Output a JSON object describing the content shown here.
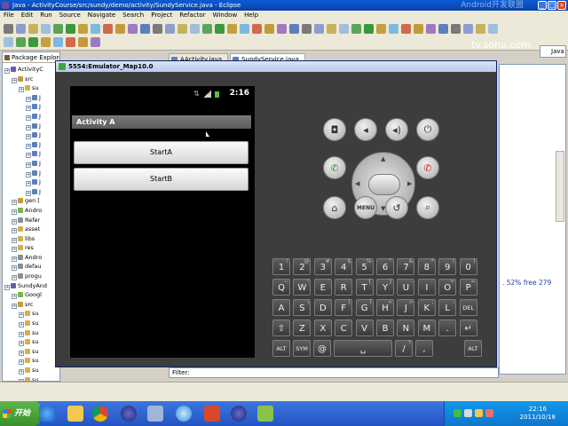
{
  "ide": {
    "window_title": "Java - ActivityCourse/src/sundy/demo/activity/SundyService.java - Eclipse",
    "watermark": "Android开发联盟",
    "menus": [
      "File",
      "Edit",
      "Run",
      "Source",
      "Navigate",
      "Search",
      "Project",
      "Refactor",
      "Window",
      "Help"
    ],
    "perspective": "Java",
    "package_explorer_title": "Package Explorer",
    "editor_tabs": [
      "AActivity.java",
      "SundyService.java"
    ],
    "heap_text": ". 52% free 279",
    "filter_label": "Filter:",
    "filter_value": "",
    "sohu": "tv.sohu.com"
  },
  "tree": [
    {
      "label": "ActivityC",
      "indent": 0,
      "color": "#6b5ba8"
    },
    {
      "label": "src",
      "indent": 1,
      "color": "#c49a3a"
    },
    {
      "label": "su",
      "indent": 2,
      "color": "#d4b04a"
    },
    {
      "label": "J",
      "indent": 3,
      "color": "#5c7fbd"
    },
    {
      "label": "J",
      "indent": 3,
      "color": "#5c7fbd"
    },
    {
      "label": "J",
      "indent": 3,
      "color": "#5c7fbd"
    },
    {
      "label": "J",
      "indent": 3,
      "color": "#5c7fbd"
    },
    {
      "label": "J",
      "indent": 3,
      "color": "#5c7fbd"
    },
    {
      "label": "J",
      "indent": 3,
      "color": "#5c7fbd"
    },
    {
      "label": "J",
      "indent": 3,
      "color": "#5c7fbd"
    },
    {
      "label": "J",
      "indent": 3,
      "color": "#5c7fbd"
    },
    {
      "label": "J",
      "indent": 3,
      "color": "#5c7fbd"
    },
    {
      "label": "J",
      "indent": 3,
      "color": "#5c7fbd"
    },
    {
      "label": "J",
      "indent": 3,
      "color": "#5c7fbd"
    },
    {
      "label": "gen [",
      "indent": 1,
      "color": "#c49a3a"
    },
    {
      "label": "Andro",
      "indent": 1,
      "color": "#7cb342"
    },
    {
      "label": "Refer",
      "indent": 1,
      "color": "#8d8d8d"
    },
    {
      "label": "asset",
      "indent": 1,
      "color": "#d4b04a"
    },
    {
      "label": "libs",
      "indent": 1,
      "color": "#d4b04a"
    },
    {
      "label": "res",
      "indent": 1,
      "color": "#d4b04a"
    },
    {
      "label": "Andro",
      "indent": 1,
      "color": "#8d8d8d"
    },
    {
      "label": "defau",
      "indent": 1,
      "color": "#8d8d8d"
    },
    {
      "label": "progu",
      "indent": 1,
      "color": "#8d8d8d"
    },
    {
      "label": "SundyAnd",
      "indent": 0,
      "color": "#6b5ba8"
    },
    {
      "label": "Googl",
      "indent": 1,
      "color": "#7cb342"
    },
    {
      "label": "src",
      "indent": 1,
      "color": "#c49a3a"
    },
    {
      "label": "su",
      "indent": 2,
      "color": "#d4b04a"
    },
    {
      "label": "su",
      "indent": 2,
      "color": "#d4b04a"
    },
    {
      "label": "su",
      "indent": 2,
      "color": "#d4b04a"
    },
    {
      "label": "su",
      "indent": 2,
      "color": "#d4b04a"
    },
    {
      "label": "su",
      "indent": 2,
      "color": "#d4b04a"
    },
    {
      "label": "su",
      "indent": 2,
      "color": "#d4b04a"
    },
    {
      "label": "su",
      "indent": 2,
      "color": "#d4b04a"
    },
    {
      "label": "su",
      "indent": 2,
      "color": "#d4b04a"
    },
    {
      "label": "su",
      "indent": 2,
      "color": "#d4b04a"
    },
    {
      "label": "su",
      "indent": 2,
      "color": "#d4b04a"
    }
  ],
  "emulator": {
    "title": "5554:Emulator_Map10.0",
    "clock": "2:16",
    "activity_title": "Activity A",
    "button_a": "StartA",
    "button_b": "StartB",
    "menu_label": "MENU"
  },
  "keyboard": {
    "rows": [
      [
        {
          "k": "1",
          "s": "!"
        },
        {
          "k": "2",
          "s": "@"
        },
        {
          "k": "3",
          "s": "#"
        },
        {
          "k": "4",
          "s": "$"
        },
        {
          "k": "5",
          "s": "%"
        },
        {
          "k": "6",
          "s": "^"
        },
        {
          "k": "7",
          "s": "&"
        },
        {
          "k": "8",
          "s": "*"
        },
        {
          "k": "9",
          "s": "("
        },
        {
          "k": "0",
          "s": ")"
        }
      ],
      [
        {
          "k": "Q",
          "s": "~"
        },
        {
          "k": "W",
          "s": "\""
        },
        {
          "k": "E",
          "s": "`"
        },
        {
          "k": "R",
          "s": ""
        },
        {
          "k": "T",
          "s": "{"
        },
        {
          "k": "Y",
          "s": "}"
        },
        {
          "k": "U",
          "s": "-"
        },
        {
          "k": "I",
          "s": ""
        },
        {
          "k": "O",
          "s": "+"
        },
        {
          "k": "P",
          "s": "="
        }
      ],
      [
        {
          "k": "A",
          "s": ""
        },
        {
          "k": "S",
          "s": "\\"
        },
        {
          "k": "D",
          "s": ""
        },
        {
          "k": "F",
          "s": "["
        },
        {
          "k": "G",
          "s": "]"
        },
        {
          "k": "H",
          "s": "<"
        },
        {
          "k": "J",
          "s": ">"
        },
        {
          "k": "K",
          "s": ";"
        },
        {
          "k": "L",
          "s": ":"
        },
        {
          "k": "DEL",
          "s": ""
        }
      ],
      [
        {
          "k": "⇧",
          "s": ""
        },
        {
          "k": "Z",
          "s": ""
        },
        {
          "k": "X",
          "s": ""
        },
        {
          "k": "C",
          "s": ""
        },
        {
          "k": "V",
          "s": ""
        },
        {
          "k": "B",
          "s": ""
        },
        {
          "k": "N",
          "s": ""
        },
        {
          "k": "M",
          "s": ""
        },
        {
          "k": ".",
          "s": ""
        },
        {
          "k": "↵",
          "s": ""
        }
      ],
      [
        {
          "k": "ALT",
          "s": ""
        },
        {
          "k": "SYM",
          "s": ""
        },
        {
          "k": "@",
          "s": ""
        },
        {
          "k": "␣",
          "s": ""
        },
        {
          "k": "/",
          "s": "?"
        },
        {
          "k": ",",
          "s": ""
        },
        {
          "k": "ALT",
          "s": ""
        }
      ]
    ]
  },
  "taskbar": {
    "start_label": "开始",
    "time": "22:16",
    "date": "2011/10/18"
  }
}
